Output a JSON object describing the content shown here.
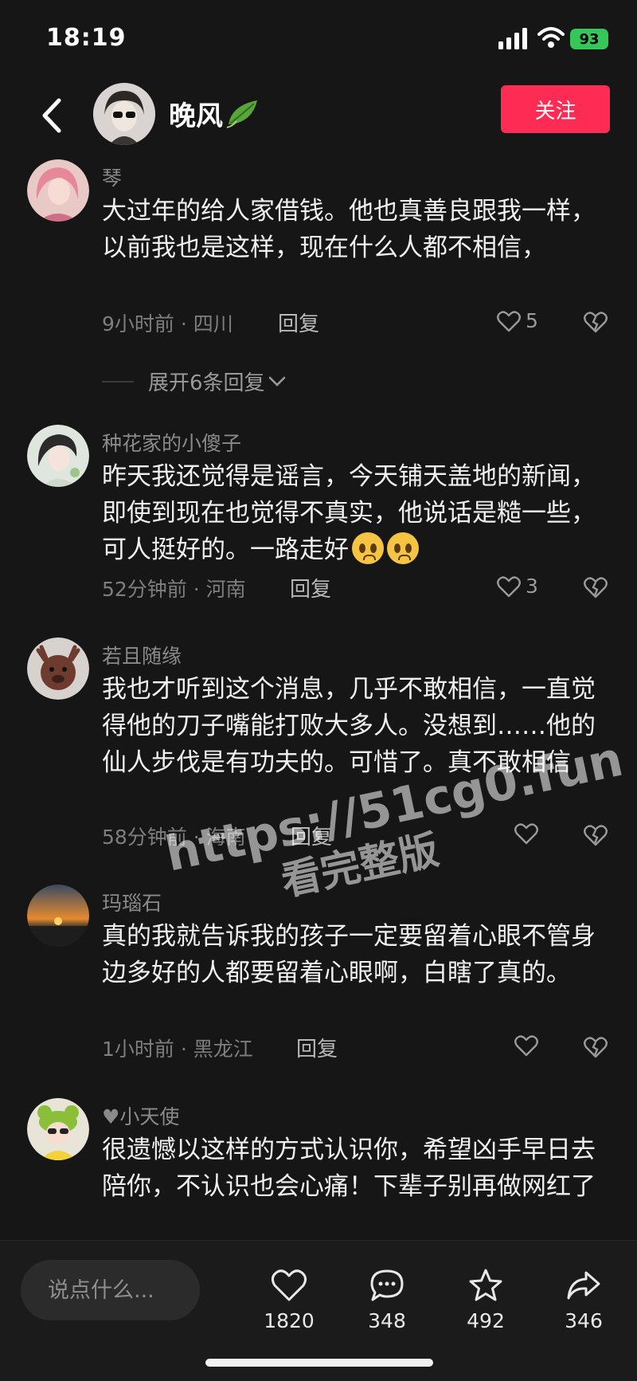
{
  "status_bar": {
    "time": "18:19",
    "battery": "93"
  },
  "header": {
    "username": "晚风",
    "follow_label": "关注"
  },
  "comments": [
    {
      "name": "琴",
      "text": "大过年的给人家借钱。他也真善良跟我一样，以前我也是这样，现在什么人都不相信，",
      "meta": "9小时前 · 四川",
      "reply": "回复",
      "likes": "5",
      "expand": "展开6条回复"
    },
    {
      "name": "种花家的小傻子",
      "text": "昨天我还觉得是谣言，今天铺天盖地的新闻，即使到现在也觉得不真实，他说话是糙一些，可人挺好的。一路走好",
      "meta": "52分钟前 · 河南",
      "reply": "回复",
      "likes": "3"
    },
    {
      "name": "若且随缘",
      "text": "我也才听到这个消息，几乎不敢相信，一直觉得他的刀子嘴能打败大多人。没想到……他的仙人步伐是有功夫的。可惜了。真不敢相信",
      "meta": "58分钟前 · 海南",
      "reply": "回复",
      "likes": ""
    },
    {
      "name": "玛瑙石",
      "text": "真的我就告诉我的孩子一定要留着心眼不管身边多好的人都要留着心眼啊，白瞎了真的。",
      "meta": "1小时前 · 黑龙江",
      "reply": "回复",
      "likes": ""
    },
    {
      "name": "♥小天使",
      "text": "很遗憾以这样的方式认识你，希望凶手早日去陪你，不认识也会心痛！下辈子别再做网红了"
    }
  ],
  "watermark": {
    "line1": "https://51cg0.fun",
    "line2": "看完整版"
  },
  "bottom_bar": {
    "input_placeholder": "说点什么...",
    "likes": "1820",
    "comments": "348",
    "favorites": "492",
    "shares": "346"
  },
  "colors": {
    "accent": "#fe2c55",
    "background": "#161616",
    "battery": "#35c759"
  }
}
